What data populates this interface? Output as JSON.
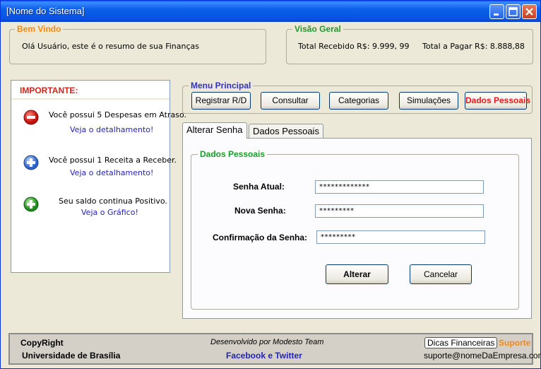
{
  "window": {
    "title": "[Nome do Sistema]"
  },
  "welcome": {
    "title": "Bem Vindo",
    "message": "Olá Usuário, este é o resumo de sua Finanças"
  },
  "overview": {
    "title": "Visão Geral",
    "received": "Total Recebido R$: 9.999, 99",
    "to_pay": "Total a Pagar R$: 8.888,88"
  },
  "important": {
    "title": "IMPORTANTE:",
    "items": [
      {
        "icon": "minus-circle-icon",
        "text": "Você possui 5 Despesas em Atraso.",
        "link": "Veja o detalhamento!"
      },
      {
        "icon": "plus-circle-icon",
        "text": "Você possui 1 Receita a Receber.",
        "link": "Veja o detalhamento!"
      },
      {
        "icon": "plus-circle-green-icon",
        "text": "Seu saldo continua Positivo.",
        "link": "Veja o Gráfico!"
      }
    ]
  },
  "menu": {
    "title": "Menu Principal",
    "buttons": [
      "Registrar R/D",
      "Consultar",
      "Categorias",
      "Simulações",
      "Dados Pessoais"
    ]
  },
  "tabs": [
    "Alterar Senha",
    "Dados Pessoais"
  ],
  "form": {
    "title": "Dados Pessoais",
    "current_label": "Senha Atual:",
    "current_value": "*************",
    "new_label": "Nova Senha:",
    "new_value": "*********",
    "confirm_label": "Confirmação da Senha:",
    "confirm_value": "*********",
    "submit": "Alterar",
    "cancel": "Cancelar"
  },
  "footer": {
    "copyright": "CopyRight",
    "university": "Universidade de Brasília",
    "developed": "Desenvolvido por Modesto Team",
    "social": "Facebook e Twitter",
    "tips": "Dicas Financeiras",
    "support": "Suporte",
    "email": "suporte@nomeDaEmpresa.com"
  },
  "colors": {
    "accent_orange": "#f28a12",
    "accent_green": "#1d9a2c",
    "accent_blue": "#3131c8",
    "alert_red": "#e81a1a",
    "titlebar": "#0653e0"
  }
}
